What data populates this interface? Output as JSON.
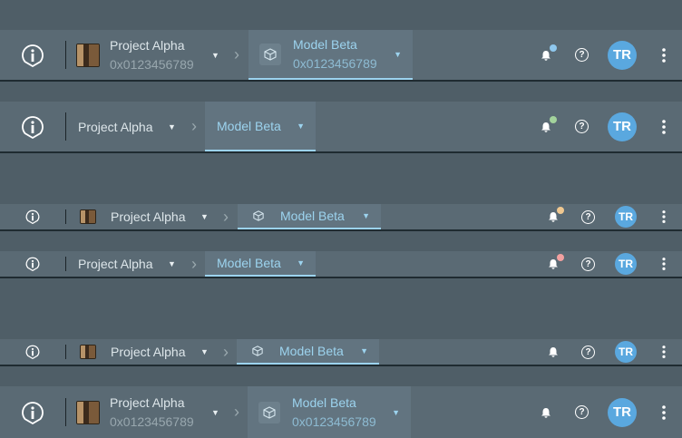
{
  "bars": [
    {
      "project": "Project Alpha",
      "project_id": "0x0123456789",
      "model": "Model Beta",
      "model_id": "0x0123456789",
      "notification_dot": "#8fc8ee",
      "avatar": "TR"
    },
    {
      "project": "Project Alpha",
      "model": "Model Beta",
      "notification_dot": "#a3d39c",
      "avatar": "TR"
    },
    {
      "project": "Project Alpha",
      "model": "Model Beta",
      "notification_dot": "#f0c890",
      "avatar": "TR"
    },
    {
      "project": "Project Alpha",
      "model": "Model Beta",
      "notification_dot": "#f2a0a0",
      "avatar": "TR"
    },
    {
      "project": "Project Alpha",
      "model": "Model Beta",
      "avatar": "TR"
    },
    {
      "project": "Project Alpha",
      "project_id": "0x0123456789",
      "model": "Model Beta",
      "model_id": "0x0123456789",
      "avatar": "TR"
    }
  ],
  "icons": {
    "logo": "info-pin-icon",
    "dropdown": "caret-down-icon",
    "breadcrumb_separator": "chevron-right-icon",
    "model": "cube-icon",
    "notifications": "bell-icon",
    "help": "help-circle-icon",
    "more": "kebab-menu-icon"
  },
  "accent_color": "#9cd3ee"
}
